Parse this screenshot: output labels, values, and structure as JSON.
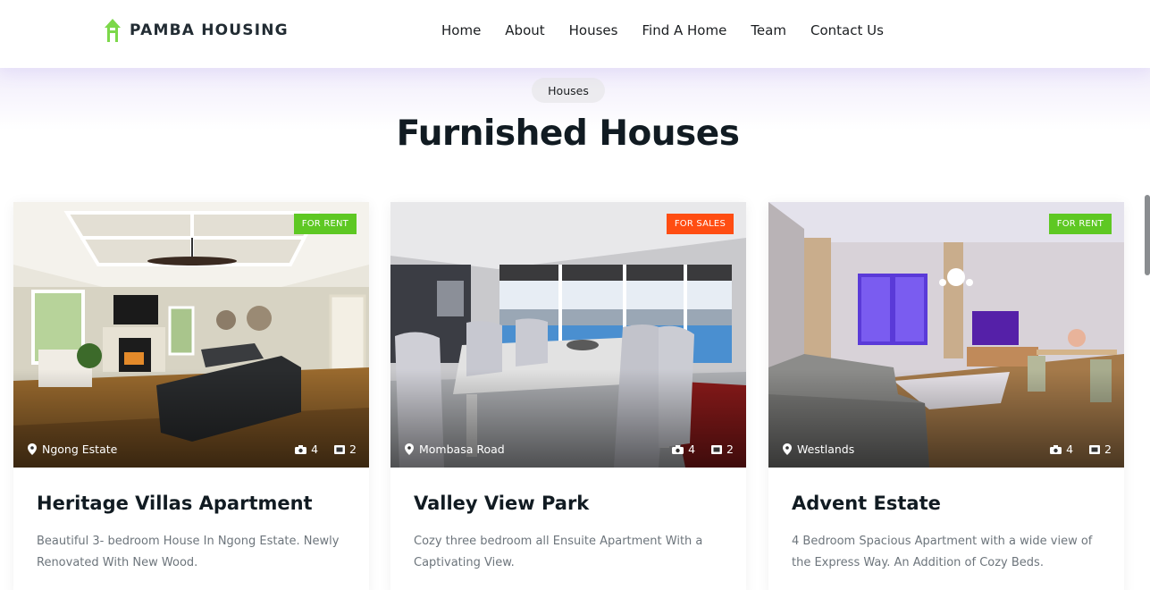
{
  "brand": {
    "name": "PAMBA HOUSING",
    "logo_color": "#7cd84a"
  },
  "nav": [
    {
      "label": "Home"
    },
    {
      "label": "About"
    },
    {
      "label": "Houses"
    },
    {
      "label": "Find A Home"
    },
    {
      "label": "Team"
    },
    {
      "label": "Contact Us"
    }
  ],
  "section": {
    "pill": "Houses",
    "heading": "Furnished Houses"
  },
  "colors": {
    "rent_badge": "#5ec823",
    "sale_badge": "#ff4d12",
    "heading": "#111b22",
    "body_text": "#6d757c"
  },
  "listings": [
    {
      "badge": "FOR RENT",
      "badge_type": "rent",
      "location": "Ngong Estate",
      "photos": "4",
      "videos": "2",
      "title": "Heritage Villas Apartment",
      "description": "Beautiful 3- bedroom House In Ngong Estate. Newly Renovated With New Wood."
    },
    {
      "badge": "FOR SALES",
      "badge_type": "sale",
      "location": "Mombasa Road",
      "photos": "4",
      "videos": "2",
      "title": "Valley View Park",
      "description": "Cozy three bedroom all Ensuite Apartment With a Captivating View."
    },
    {
      "badge": "FOR RENT",
      "badge_type": "rent",
      "location": "Westlands",
      "photos": "4",
      "videos": "2",
      "title": "Advent Estate",
      "description": "4 Bedroom Spacious Apartment with a wide view of the Express Way. An Addition of Cozy Beds."
    }
  ]
}
